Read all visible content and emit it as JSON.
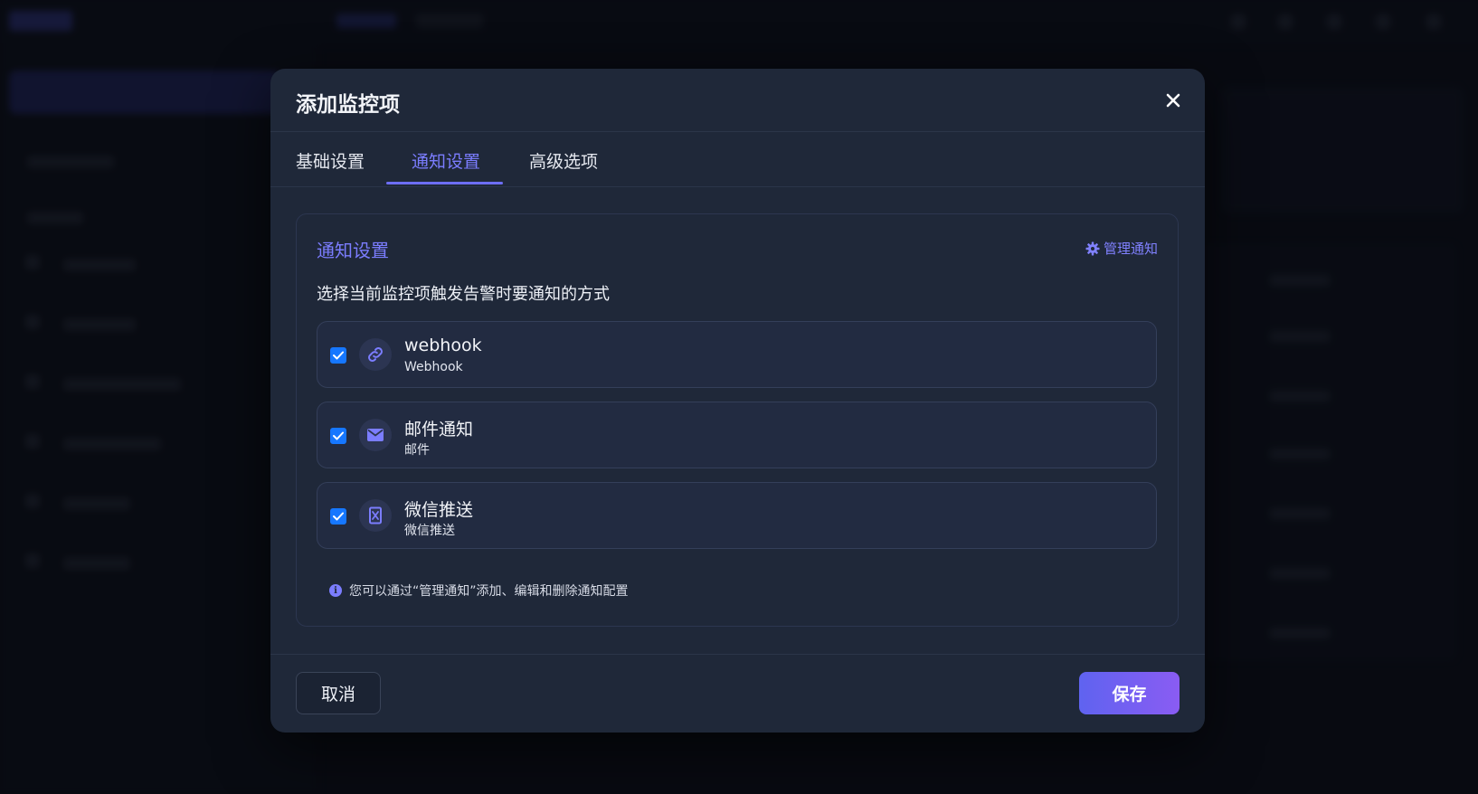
{
  "modal": {
    "title": "添加监控项",
    "close_label": "✕"
  },
  "tabs": [
    {
      "label": "基础设置",
      "active": false
    },
    {
      "label": "通知设置",
      "active": true
    },
    {
      "label": "高级选项",
      "active": false
    }
  ],
  "notification_section": {
    "title": "通知设置",
    "manage_label": "管理通知",
    "description": "选择当前监控项触发告警时要通知的方式",
    "items": [
      {
        "name": "webhook",
        "type": "Webhook",
        "checked": true,
        "icon": "link-icon"
      },
      {
        "name": "邮件通知",
        "type": "邮件",
        "checked": true,
        "icon": "envelope-icon"
      },
      {
        "name": "微信推送",
        "type": "微信推送",
        "checked": true,
        "icon": "wechat-icon"
      }
    ],
    "hint": "您可以通过“管理通知”添加、编辑和删除通知配置"
  },
  "footer": {
    "cancel_label": "取消",
    "save_label": "保存"
  },
  "colors": {
    "accent": "#7b7dff",
    "checkbox": "#1677ff",
    "modal_bg": "#1f2839"
  }
}
